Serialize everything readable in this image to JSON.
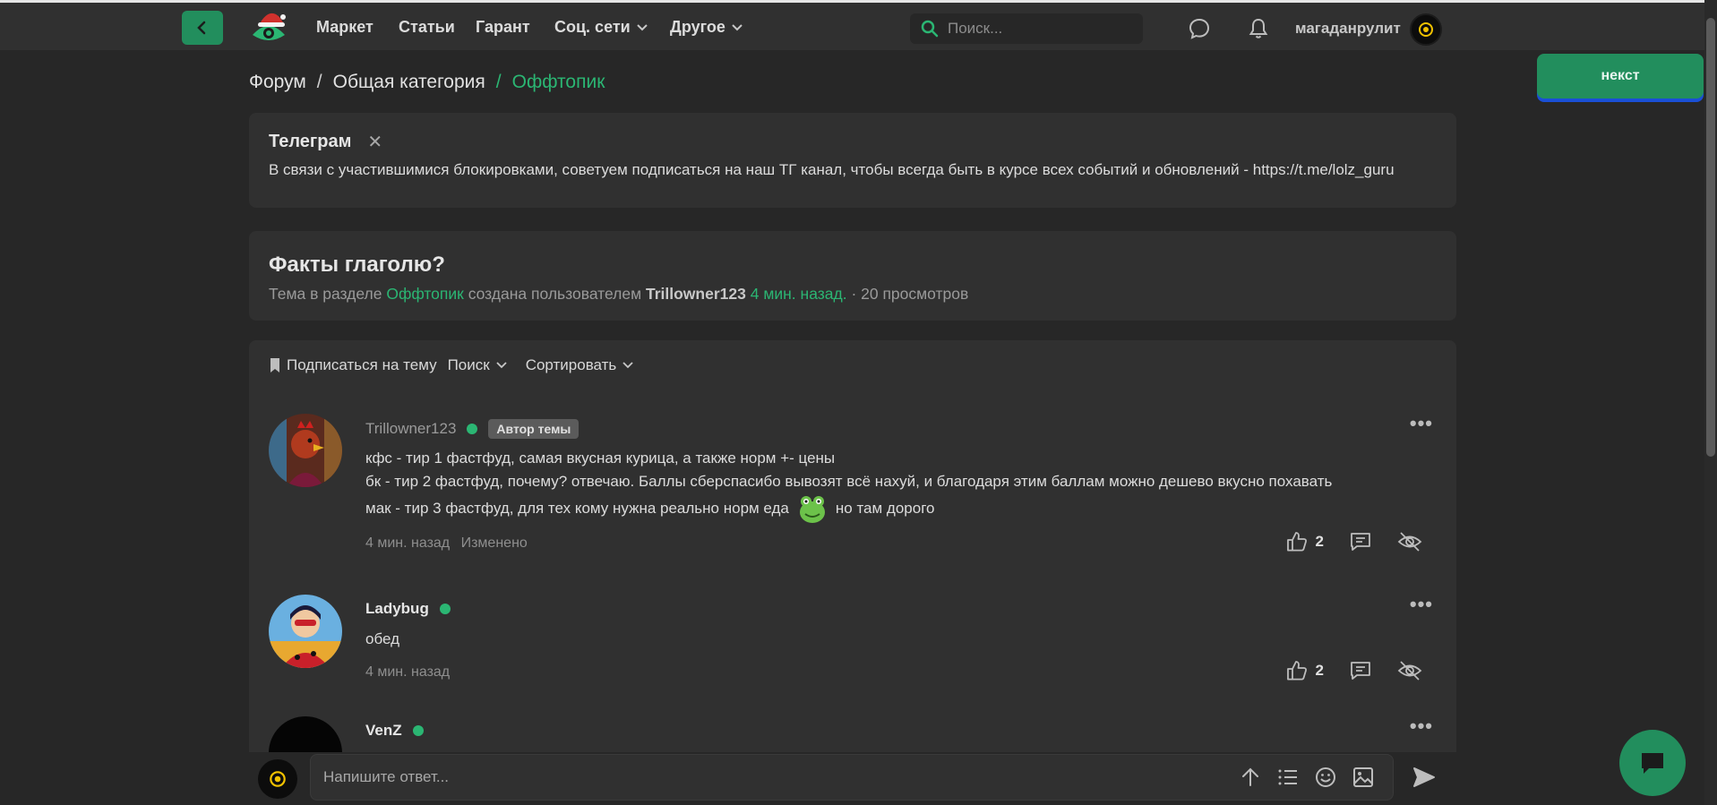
{
  "nav": {
    "links": [
      {
        "label": "Маркет",
        "dropdown": false
      },
      {
        "label": "Статьи",
        "dropdown": false
      },
      {
        "label": "Гарант",
        "dropdown": false
      },
      {
        "label": "Соц. сети",
        "dropdown": true
      },
      {
        "label": "Другое",
        "dropdown": true
      }
    ],
    "search_placeholder": "Поиск...",
    "username": "магаданрулит"
  },
  "floating_button": "некст",
  "breadcrumb": [
    "Форум",
    "Общая категория",
    "Оффтопик"
  ],
  "notice": {
    "title": "Телеграм",
    "text": "В связи с участившимися блокировками, советуем подписаться на наш ТГ канал, чтобы всегда быть в курсе всех событий и обновлений - https://t.me/lolz_guru"
  },
  "topic": {
    "title": "Факты глаголю?",
    "meta_prefix": "Тема в разделе",
    "section": "Оффтопик",
    "meta_mid": "создана пользователем",
    "author": "Trillowner123",
    "time": "4 мин. назад.",
    "views": "· 20 просмотров"
  },
  "toolbar": {
    "subscribe": "Подписаться на тему",
    "search": "Поиск",
    "sort": "Сортировать"
  },
  "posts": [
    {
      "author": "Trillowner123",
      "badge": "Автор темы",
      "lines": [
        "кфс - тир 1 фастфуд, самая вкусная курица, а также норм +- цены",
        "бк - тир 2 фастфуд, почему? отвечаю. Баллы сберспасибо вывозят всё нахуй, и благодаря этим баллам можно дешево вкусно похавать",
        "мак - тир 3 фастфуд, для тех кому нужна реально норм еда"
      ],
      "line3_suffix": "но там дорого",
      "time": "4 мин. назад",
      "edited": "Изменено",
      "likes": "2"
    },
    {
      "author": "Ladybug",
      "lines": [
        "обед"
      ],
      "time": "4 мин. назад",
      "likes": "2"
    },
    {
      "author": "VenZ"
    }
  ],
  "reply": {
    "placeholder": "Напишите ответ..."
  },
  "colors": {
    "accent": "#2bb673",
    "button": "#228e5d",
    "background": "#272727",
    "card": "#303030"
  }
}
